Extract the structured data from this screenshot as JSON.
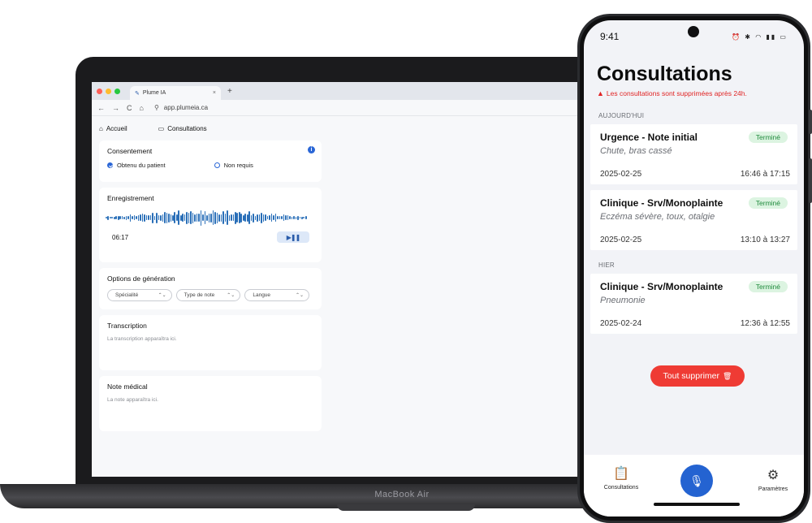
{
  "laptop": {
    "brand_label": "MacBook Air",
    "browser": {
      "tab_title": "Plume IA",
      "tab_close": "×",
      "new_tab": "+",
      "nav": {
        "back": "←",
        "forward": "→",
        "reload": "C",
        "home": "⌂"
      },
      "url": "app.plumeia.ca",
      "traffic_colors": [
        "#fe5f57",
        "#febc2e",
        "#28c840"
      ]
    },
    "app": {
      "nav_items": [
        {
          "icon": "home-icon",
          "glyph": "⌂",
          "label": "Accueil"
        },
        {
          "icon": "archive-icon",
          "glyph": "▭",
          "label": "Consultations"
        }
      ],
      "consent": {
        "title": "Consentement",
        "info_glyph": "i",
        "options": [
          {
            "label": "Obtenu du patient",
            "selected": true
          },
          {
            "label": "Non requis",
            "selected": false
          }
        ]
      },
      "recording": {
        "title": "Enregistrement",
        "duration": "06:17",
        "play_pause": "▶❚❚"
      },
      "generation": {
        "title": "Options de génération",
        "selects": [
          {
            "value": "Spécialité"
          },
          {
            "value": "Type de note"
          },
          {
            "value": "Langue"
          }
        ],
        "chevron": "⌃⌄"
      },
      "transcription": {
        "title": "Transcription",
        "placeholder": "La transcription apparaîtra ici."
      },
      "note": {
        "title": "Note médical",
        "placeholder": "La note apparaîtra ici."
      }
    }
  },
  "phone": {
    "status_time": "9:41",
    "status_icons": "⏰ ✱ ◠ ▮▮ ▭",
    "title": "Consultations",
    "warning": "Les consultations sont supprimées après 24h.",
    "warning_glyph": "▲",
    "sections": [
      {
        "label": "AUJOURD'HUI",
        "items": [
          {
            "title": "Urgence - Note initial",
            "subtitle": "Chute, bras cassé",
            "status": "Terminé",
            "date": "2025-02-25",
            "time": "16:46 à 17:15"
          },
          {
            "title": "Clinique - Srv/Monoplainte",
            "subtitle": "Eczéma sévère, toux, otalgie",
            "status": "Terminé",
            "date": "2025-02-25",
            "time": "13:10 à 13:27"
          }
        ]
      },
      {
        "label": "HIER",
        "items": [
          {
            "title": "Clinique - Srv/Monoplainte",
            "subtitle": "Pneumonie",
            "status": "Terminé",
            "date": "2025-02-24",
            "time": "12:36 à 12:55"
          }
        ]
      }
    ],
    "delete_all": "Tout supprimer",
    "delete_glyph": "🗑",
    "tabs": [
      {
        "label": "Consultations",
        "icon": "clipboard-icon",
        "glyph": "📋"
      },
      {
        "label": "Paramètres",
        "icon": "settings-icon",
        "glyph": "⚙"
      }
    ],
    "mic_glyph": "🎙"
  },
  "colors": {
    "accent": "#2463d1",
    "danger": "#ef3b34",
    "success_bg": "#dcf4e1",
    "success_text": "#1f8a3c"
  }
}
